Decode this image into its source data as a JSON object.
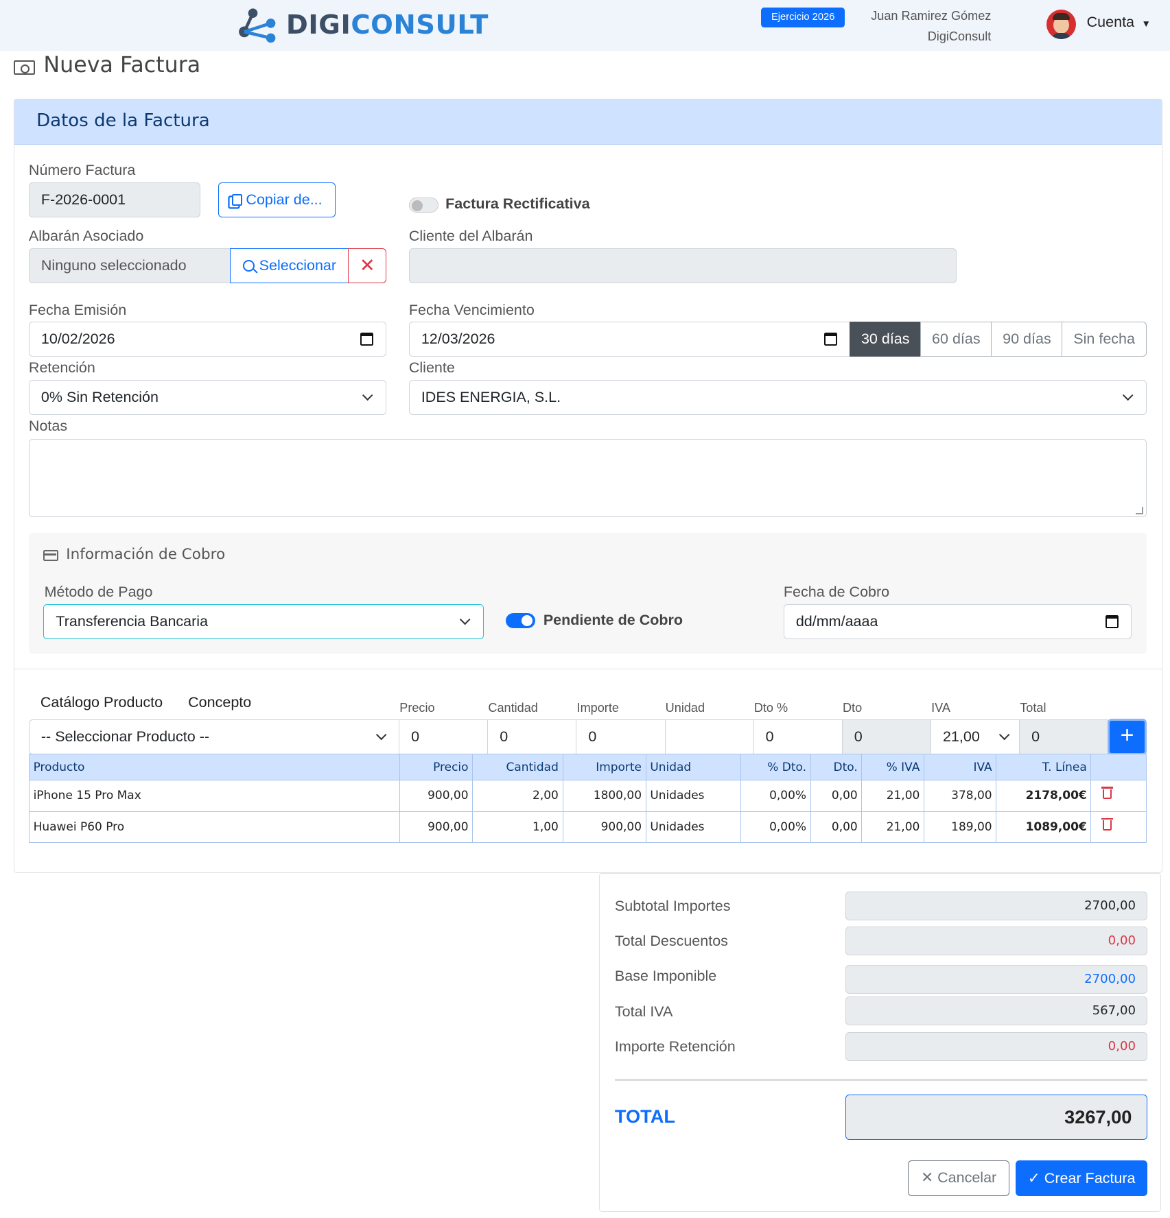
{
  "header": {
    "logo_part1": "DIGI",
    "logo_part2": "CONSULT",
    "year_badge": "Ejercicio 2026",
    "user_name": "Juan Ramirez Gómez",
    "company": "DigiConsult",
    "account_label": "Cuenta"
  },
  "page": {
    "title": "Nueva Factura"
  },
  "card": {
    "title": "Datos de la Factura"
  },
  "form": {
    "numero_label": "Número Factura",
    "numero_value": "F-2026-0001",
    "copiar_label": "Copiar de...",
    "rectificativa_label": "Factura Rectificativa",
    "albaran_label": "Albarán Asociado",
    "albaran_value": "Ninguno seleccionado",
    "seleccionar_label": "Seleccionar",
    "cliente_albaran_label": "Cliente del Albarán",
    "fecha_emision_label": "Fecha Emisión",
    "fecha_emision_value": "10/02/2026",
    "fecha_venc_label": "Fecha Vencimiento",
    "fecha_venc_value": "12/03/2026",
    "venc_options": [
      "30 días",
      "60 días",
      "90 días",
      "Sin fecha"
    ],
    "retencion_label": "Retención",
    "retencion_value": "0% Sin Retención",
    "cliente_label": "Cliente",
    "cliente_value": "IDES ENERGIA, S.L.",
    "notas_label": "Notas"
  },
  "cobro": {
    "title": "Información de Cobro",
    "metodo_label": "Método de Pago",
    "metodo_value": "Transferencia Bancaria",
    "pendiente_label": "Pendiente de Cobro",
    "fecha_label": "Fecha de Cobro",
    "fecha_placeholder": "dd/mm/aaaa"
  },
  "line_entry": {
    "tab_catalogo": "Catálogo Producto",
    "tab_concepto": "Concepto",
    "producto_value": "-- Seleccionar Producto --",
    "precio_label": "Precio",
    "precio_value": "0",
    "cantidad_label": "Cantidad",
    "cantidad_value": "0",
    "importe_label": "Importe",
    "importe_value": "0",
    "unidad_label": "Unidad",
    "unidad_value": "",
    "dto_pct_label": "Dto %",
    "dto_pct_value": "0",
    "dto_label": "Dto",
    "dto_value": "0",
    "iva_label": "IVA",
    "iva_value": "21,00",
    "total_label": "Total",
    "total_value": "0",
    "add_label": "+"
  },
  "table": {
    "headers": [
      "Producto",
      "Precio",
      "Cantidad",
      "Importe",
      "Unidad",
      "% Dto.",
      "Dto.",
      "% IVA",
      "IVA",
      "T. Línea"
    ],
    "rows": [
      [
        "iPhone 15 Pro Max",
        "900,00",
        "2,00",
        "1800,00",
        "Unidades",
        "0,00%",
        "0,00",
        "21,00",
        "378,00",
        "2178,00€"
      ],
      [
        "Huawei P60 Pro",
        "900,00",
        "1,00",
        "900,00",
        "Unidades",
        "0,00%",
        "0,00",
        "21,00",
        "189,00",
        "1089,00€"
      ]
    ]
  },
  "totals": {
    "subtotal_label": "Subtotal Importes",
    "subtotal_value": "2700,00",
    "descuentos_label": "Total Descuentos",
    "descuentos_value": "0,00",
    "base_label": "Base Imponible",
    "base_value": "2700,00",
    "iva_label": "Total IVA",
    "iva_value": "567,00",
    "retencion_label": "Importe Retención",
    "retencion_value": "0,00",
    "total_label": "TOTAL",
    "total_value": "3267,00",
    "cancel_label": "Cancelar",
    "create_label": "Crear Factura"
  },
  "colors": {
    "primary": "#0d6efd",
    "danger": "#dc3545",
    "header_bg": "#cfe2ff"
  }
}
